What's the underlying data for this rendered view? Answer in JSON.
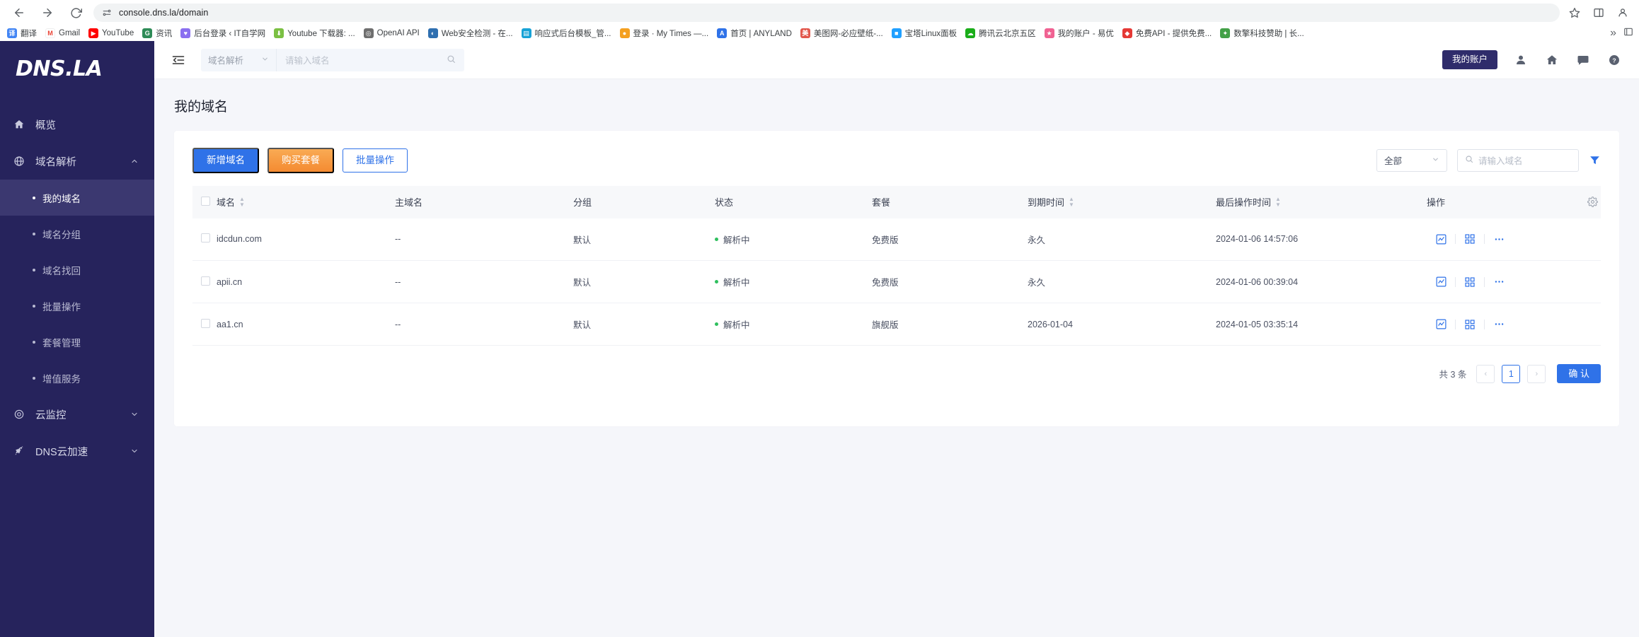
{
  "browser": {
    "url": "console.dns.la/domain",
    "nav": {
      "back": "back-arrow",
      "forward": "forward-arrow",
      "reload": "reload"
    },
    "bookmarks": [
      {
        "label": "翻译",
        "color": "#4285f4",
        "glyph": "译"
      },
      {
        "label": "Gmail",
        "color": "#ffffff",
        "glyph": "M"
      },
      {
        "label": "YouTube",
        "color": "#ff0000",
        "glyph": "▶"
      },
      {
        "label": "资讯",
        "color": "#2e8b57",
        "glyph": "G"
      },
      {
        "label": "后台登录 ‹ IT自学网",
        "color": "#8a6ff0",
        "glyph": "♥"
      },
      {
        "label": "Youtube 下载器: ...",
        "color": "#7bc043",
        "glyph": "⬇"
      },
      {
        "label": "OpenAI API",
        "color": "#6e6e6e",
        "glyph": "◎"
      },
      {
        "label": "Web安全检测 - 在...",
        "color": "#2f6fb0",
        "glyph": "◐"
      },
      {
        "label": "响应式后台模板_管...",
        "color": "#17a2d6",
        "glyph": "▤"
      },
      {
        "label": "登录 · My Times —...",
        "color": "#f4a020",
        "glyph": "●"
      },
      {
        "label": "首页 | ANYLAND",
        "color": "#2f72e8",
        "glyph": "A"
      },
      {
        "label": "美图网-必应壁纸-...",
        "color": "#e2574c",
        "glyph": "美"
      },
      {
        "label": "宝塔Linux面板",
        "color": "#20a0ff",
        "glyph": "■"
      },
      {
        "label": "腾讯云北京五区",
        "color": "#1aad19",
        "glyph": "☁"
      },
      {
        "label": "我的账户 - 易优",
        "color": "#f06292",
        "glyph": "★"
      },
      {
        "label": "免费API - 提供免费...",
        "color": "#e53935",
        "glyph": "◆"
      },
      {
        "label": "数擎科技赞助 | 长...",
        "color": "#43a047",
        "glyph": "✦"
      }
    ],
    "overflow_label": "»"
  },
  "sidebar": {
    "logo": "DNS.LA",
    "items": [
      {
        "label": "概览",
        "icon": "home-icon",
        "type": "top",
        "active": false
      },
      {
        "label": "域名解析",
        "icon": "globe-icon",
        "type": "top",
        "expanded": true,
        "active": false
      },
      {
        "label": "我的域名",
        "type": "sub",
        "active": true
      },
      {
        "label": "域名分组",
        "type": "sub",
        "active": false
      },
      {
        "label": "域名找回",
        "type": "sub",
        "active": false
      },
      {
        "label": "批量操作",
        "type": "sub",
        "active": false
      },
      {
        "label": "套餐管理",
        "type": "sub",
        "active": false
      },
      {
        "label": "增值服务",
        "type": "sub",
        "active": false
      },
      {
        "label": "云监控",
        "icon": "monitor-icon",
        "type": "top",
        "expanded": false,
        "active": false
      },
      {
        "label": "DNS云加速",
        "icon": "rocket-icon",
        "type": "top",
        "expanded": false,
        "active": false
      }
    ]
  },
  "topbar": {
    "collapse_icon": "collapse-sidebar-icon",
    "search_scope": "域名解析",
    "search_placeholder": "请输入域名",
    "account_button": "我的账户",
    "icons": [
      "user-icon",
      "home-icon",
      "message-icon",
      "help-icon"
    ]
  },
  "page": {
    "title": "我的域名"
  },
  "toolbar": {
    "add_domain": "新增域名",
    "buy_plan": "购买套餐",
    "batch_ops": "批量操作",
    "filter_value": "全部",
    "search_placeholder": "请输入域名",
    "filter_icon": "funnel-icon"
  },
  "table": {
    "columns": [
      {
        "label": "",
        "key": "checkbox",
        "sortable": false
      },
      {
        "label": "域名",
        "key": "domain",
        "sortable": true
      },
      {
        "label": "主域名",
        "key": "host",
        "sortable": false
      },
      {
        "label": "分组",
        "key": "group",
        "sortable": false
      },
      {
        "label": "状态",
        "key": "status",
        "sortable": false
      },
      {
        "label": "套餐",
        "key": "plan",
        "sortable": false
      },
      {
        "label": "到期时间",
        "key": "expire",
        "sortable": true
      },
      {
        "label": "最后操作时间",
        "key": "last_op",
        "sortable": true
      },
      {
        "label": "操作",
        "key": "ops",
        "sortable": false
      }
    ],
    "settings_icon": "gear-icon",
    "rows": [
      {
        "domain": "idcdun.com",
        "host": "--",
        "group": "默认",
        "status": "解析中",
        "status_color": "#2fbf5e",
        "plan": "免费版",
        "expire": "永久",
        "last_op": "2024-01-06 14:57:06"
      },
      {
        "domain": "apii.cn",
        "host": "--",
        "group": "默认",
        "status": "解析中",
        "status_color": "#2fbf5e",
        "plan": "免费版",
        "expire": "永久",
        "last_op": "2024-01-06 00:39:04"
      },
      {
        "domain": "aa1.cn",
        "host": "--",
        "group": "默认",
        "status": "解析中",
        "status_color": "#2fbf5e",
        "plan": "旗舰版",
        "expire": "2026-01-04",
        "last_op": "2024-01-05 03:35:14"
      }
    ],
    "row_ops": [
      "chart-icon",
      "qr-icon",
      "more-icon"
    ]
  },
  "pagination": {
    "total": "共 3 条",
    "prev": "‹",
    "current_page": "1",
    "next": "›",
    "confirm": "确 认"
  },
  "colors": {
    "brand_dark": "#26235c",
    "primary": "#2f72e8",
    "warn": "#f48b31",
    "status_green": "#2fbf5e"
  }
}
